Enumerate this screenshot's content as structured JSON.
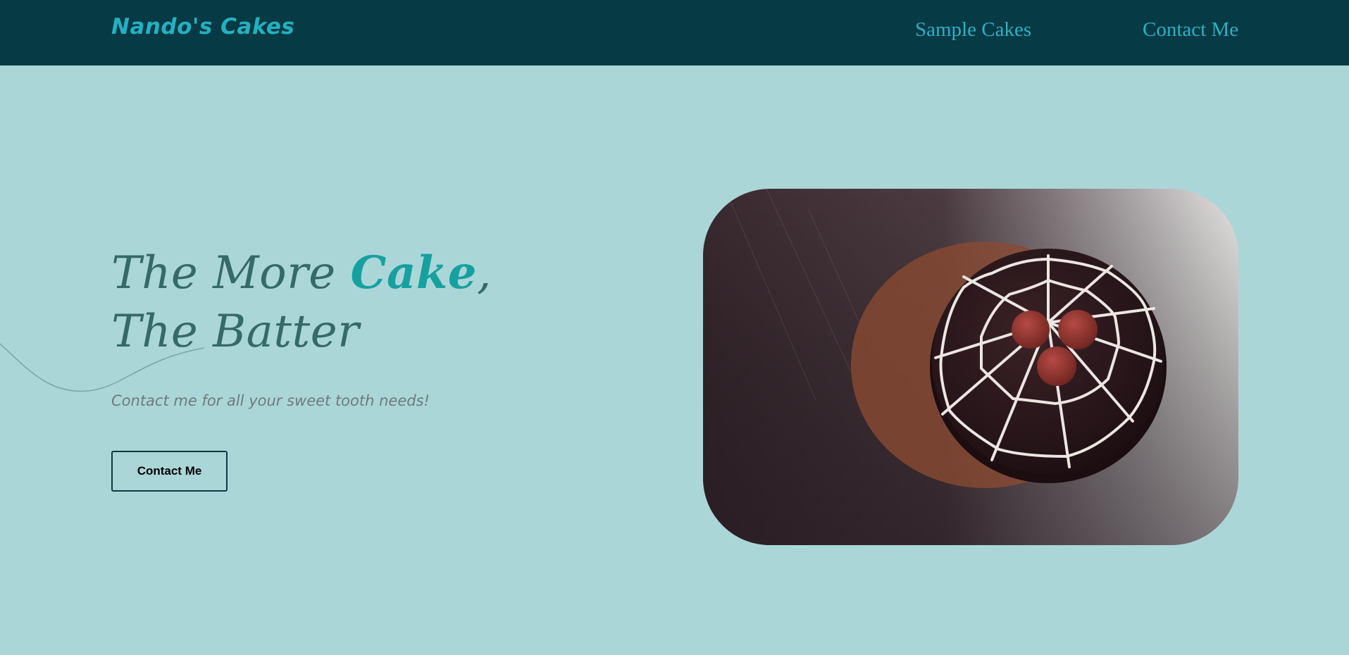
{
  "header": {
    "brand": "Nando's Cakes",
    "nav": [
      {
        "label": "Sample Cakes"
      },
      {
        "label": "Contact Me"
      }
    ]
  },
  "hero": {
    "title_part1": "The More ",
    "title_accent": "Cake",
    "title_part2": ",",
    "title_line2": "The Batter",
    "subtitle": "Contact me for all your sweet tooth needs!",
    "cta_label": "Contact Me"
  },
  "colors": {
    "nav_bg": "#063a44",
    "page_bg": "#abd6d8",
    "brand": "#22b1c2",
    "title": "#356a66",
    "title_accent": "#17a0a0"
  },
  "image": {
    "subject": "chocolate cake with white spiderweb icing and three berries"
  }
}
